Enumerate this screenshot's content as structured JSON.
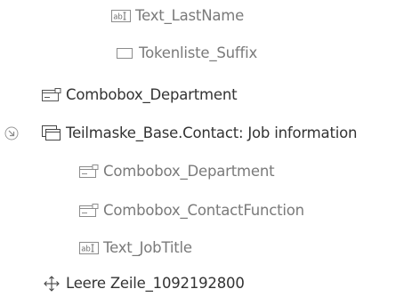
{
  "tree": {
    "items": [
      {
        "label": "Text_LastName",
        "icon": "textbox-icon"
      },
      {
        "label": "Tokenliste_Suffix",
        "icon": "token-list-icon"
      },
      {
        "label": "Combobox_Department",
        "icon": "combobox-icon"
      },
      {
        "label": "Teilmaske_Base.Contact: Job information",
        "icon": "subform-icon",
        "expander_icon": "collapse-circle-icon"
      },
      {
        "label": "Combobox_Department",
        "icon": "combobox-icon"
      },
      {
        "label": "Combobox_ContactFunction",
        "icon": "combobox-icon"
      },
      {
        "label": "Text_JobTitle",
        "icon": "textbox-icon"
      },
      {
        "label": "Leere Zeile_1092192800",
        "icon": "move-arrows-icon"
      }
    ]
  }
}
